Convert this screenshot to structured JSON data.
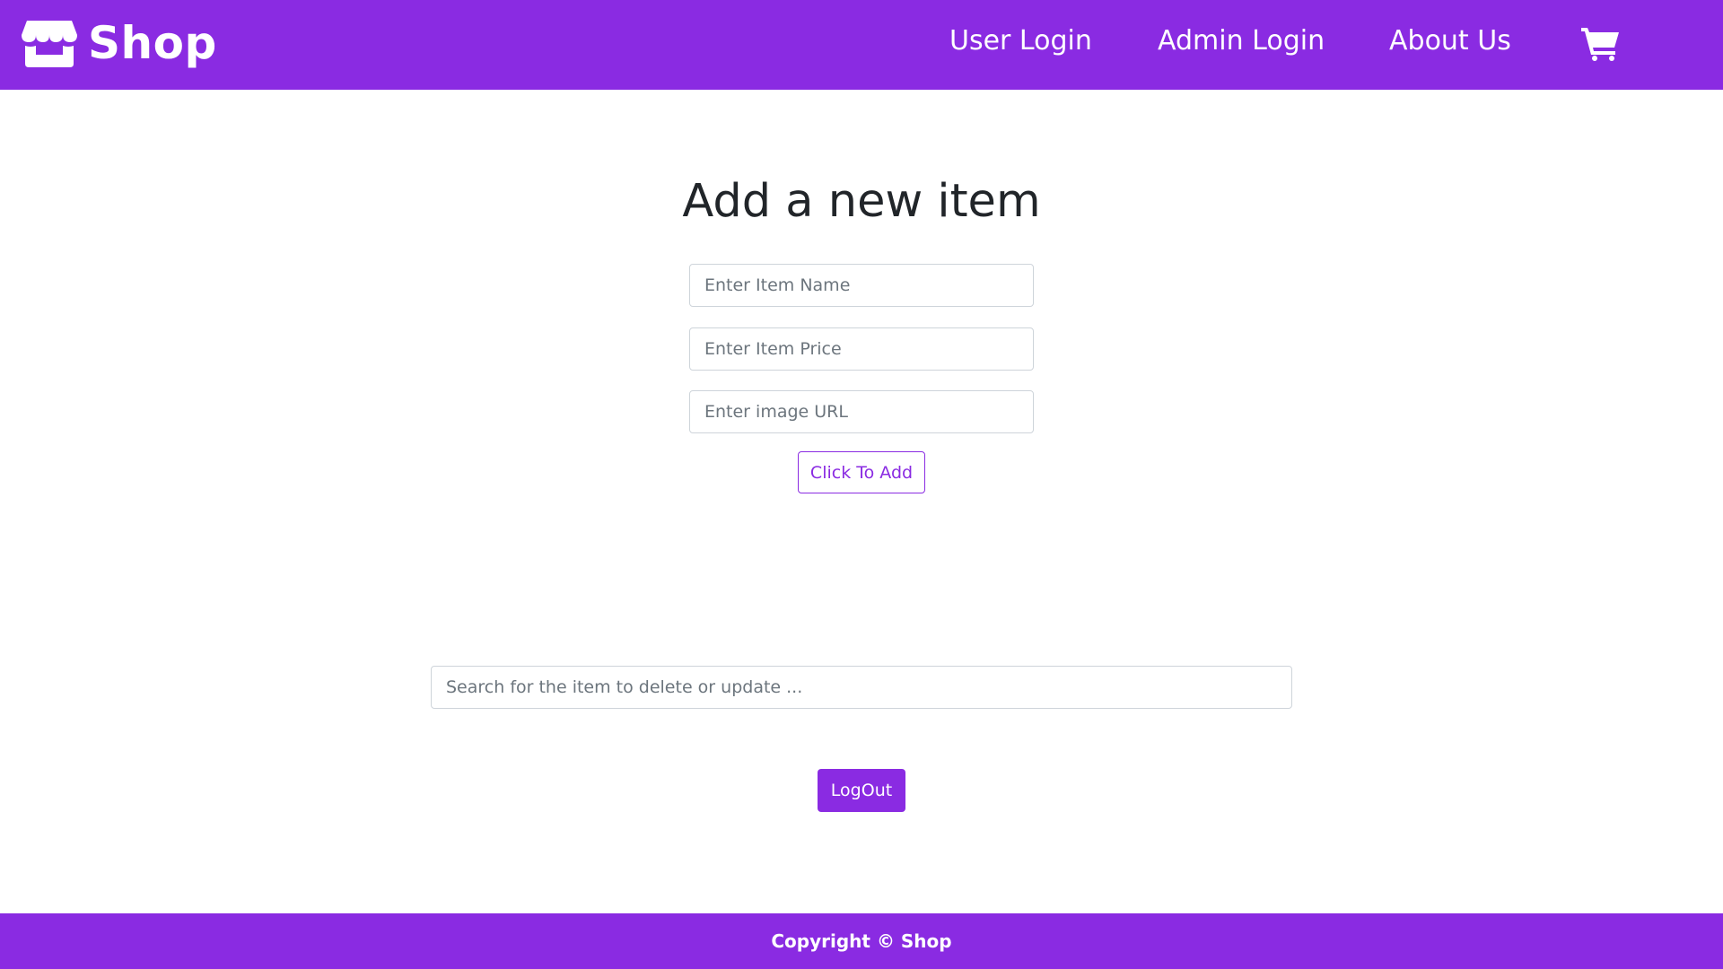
{
  "colors": {
    "brand": "#8a2be2",
    "text": "#212529",
    "placeholder": "#6c757d",
    "border": "#ced4da"
  },
  "navbar": {
    "brand_icon": "store-icon",
    "brand_name": "Shop",
    "links": [
      {
        "label": "User Login"
      },
      {
        "label": "Admin Login"
      },
      {
        "label": "About Us"
      }
    ],
    "cart_icon": "shopping-cart-icon"
  },
  "form": {
    "title": "Add a new item",
    "item_name_placeholder": "Enter Item Name",
    "item_price_placeholder": "Enter Item Price",
    "image_url_placeholder": "Enter image URL",
    "add_button_label": "Click To Add"
  },
  "search": {
    "placeholder": "Search for the item to delete or update ..."
  },
  "logout_label": "LogOut",
  "footer": {
    "text": "Copyright © Shop"
  }
}
